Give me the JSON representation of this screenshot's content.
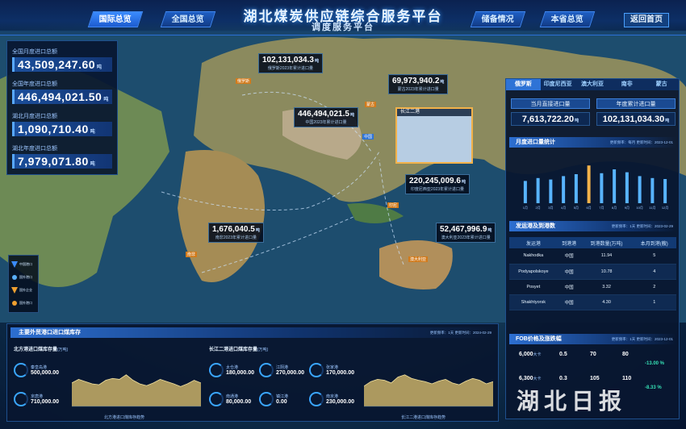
{
  "header": {
    "title": "湖北煤炭供应链综合服务平台",
    "subtitle": "调度服务平台",
    "tabs_left": [
      "国际总览",
      "全国总览"
    ],
    "tabs_right": [
      "储备情况",
      "本省总览"
    ],
    "home_label": "返回首页"
  },
  "left_stats": [
    {
      "label": "全国月度进口总额",
      "value": "43,509,247.60",
      "unit": "吨"
    },
    {
      "label": "全国年度进口总额",
      "value": "446,494,021.50",
      "unit": "吨"
    },
    {
      "label": "湖北月度进口总额",
      "value": "1,090,710.40",
      "unit": "吨"
    },
    {
      "label": "湖北年度进口总额",
      "value": "7,979,071.80",
      "unit": "吨"
    }
  ],
  "map_callouts": [
    {
      "value": "102,131,034.3",
      "unit": "吨",
      "desc": "俄罗斯2023年累计进口量"
    },
    {
      "value": "69,973,940.2",
      "unit": "吨",
      "desc": "蒙古2023年累计进口量"
    },
    {
      "value": "446,494,021.5",
      "unit": "吨",
      "desc": "中国2023年累计进口量"
    },
    {
      "value": "220,245,009.6",
      "unit": "吨",
      "desc": "印度尼西亚2023年累计进口量"
    },
    {
      "value": "1,676,040.5",
      "unit": "吨",
      "desc": "南非2023年累计进口量"
    },
    {
      "value": "52,467,996.9",
      "unit": "吨",
      "desc": "澳大利亚2023年累计进口量"
    }
  ],
  "map_origins": [
    "俄罗斯",
    "蒙古",
    "中国",
    "印尼",
    "南非",
    "澳大利亚"
  ],
  "inset_title": "长江二港",
  "legend": [
    "中国港口",
    "国外港口",
    "国外企业",
    "国外港口"
  ],
  "right_panel": {
    "tabs": [
      "俄罗斯",
      "印度尼西亚",
      "澳大利亚",
      "南非",
      "蒙古"
    ],
    "kpi": [
      {
        "label": "当月直接进口量",
        "value": "7,613,722.20",
        "unit": "吨"
      },
      {
        "label": "年度累计进口量",
        "value": "102,131,034.30",
        "unit": "吨"
      }
    ],
    "monthly_title": "月度进口量统计",
    "monthly_meta": "更新频率：每月  更新时间：2023-12-01",
    "monthly_values": [
      0.46,
      0.52,
      0.49,
      0.56,
      0.6,
      0.78,
      0.62,
      0.7,
      0.64,
      0.56,
      0.52,
      0.5
    ],
    "monthly_ticks": [
      "1月",
      "2月",
      "3月",
      "4月",
      "5月",
      "6月",
      "7月",
      "8月",
      "9月",
      "10月",
      "11月",
      "12月"
    ],
    "ship_title": "发运港及到港数",
    "ship_meta": "更新频率：1天  更新时间：2023-02-29",
    "ship_columns": [
      "发运港",
      "到港港",
      "到港数量(万吨)",
      "本月到港(艘)"
    ],
    "ship_rows": [
      [
        "Nakhodka",
        "中国",
        "11.94",
        "5"
      ],
      [
        "Podyapolskoye",
        "中国",
        "10.78",
        "4"
      ],
      [
        "Posyet",
        "中国",
        "3.32",
        "2"
      ],
      [
        "Shakhtyorsk",
        "中国",
        "4.30",
        "1"
      ]
    ],
    "fob_title": "FOB价格及涨跌幅",
    "fob_meta": "更新频率：1天  更新时间：2023-12-01",
    "fob_rows": [
      {
        "a": "6,000",
        "au": "大卡",
        "b": "0.5",
        "c": "70",
        "d": "80",
        "e": "-13.00 %"
      },
      {
        "a": "6,300",
        "au": "大卡",
        "b": "0.3",
        "c": "105",
        "d": "110",
        "e": "-8.33 %"
      }
    ]
  },
  "bottom_panel": {
    "title": "主要外贸港口进口煤库存",
    "meta": "更新频率：1天  更新时间：2024-02-29",
    "north": {
      "title": "北方港进口煤库存量",
      "unit": "(万吨)",
      "gauges": [
        {
          "label": "秦皇岛港",
          "value": "500,000.00"
        },
        {
          "label": "京唐港",
          "value": "710,000.00"
        }
      ],
      "series": [
        0.52,
        0.6,
        0.55,
        0.5,
        0.48,
        0.58,
        0.62,
        0.6,
        0.7,
        0.58,
        0.5,
        0.46,
        0.52,
        0.6,
        0.55,
        0.5,
        0.44,
        0.5,
        0.58,
        0.52
      ],
      "caption": "北方港进口煤库存趋势"
    },
    "yangtze": {
      "title": "长江二港进口煤库存量",
      "unit": "(万吨)",
      "gauges": [
        {
          "label": "太仓港",
          "value": "180,000.00"
        },
        {
          "label": "江阴港",
          "value": "270,000.00"
        },
        {
          "label": "张家港",
          "value": "170,000.00"
        },
        {
          "label": "南通港",
          "value": "80,000.00"
        },
        {
          "label": "镇江港",
          "value": "0.00"
        },
        {
          "label": "南京港",
          "value": "230,000.00"
        }
      ],
      "series": [
        0.45,
        0.55,
        0.6,
        0.58,
        0.52,
        0.65,
        0.7,
        0.62,
        0.58,
        0.55,
        0.5,
        0.56,
        0.6,
        0.52,
        0.48,
        0.56,
        0.62,
        0.58,
        0.5,
        0.55
      ],
      "caption": "长江二港进口煤库存趋势"
    }
  },
  "watermark": "湖北日报"
}
